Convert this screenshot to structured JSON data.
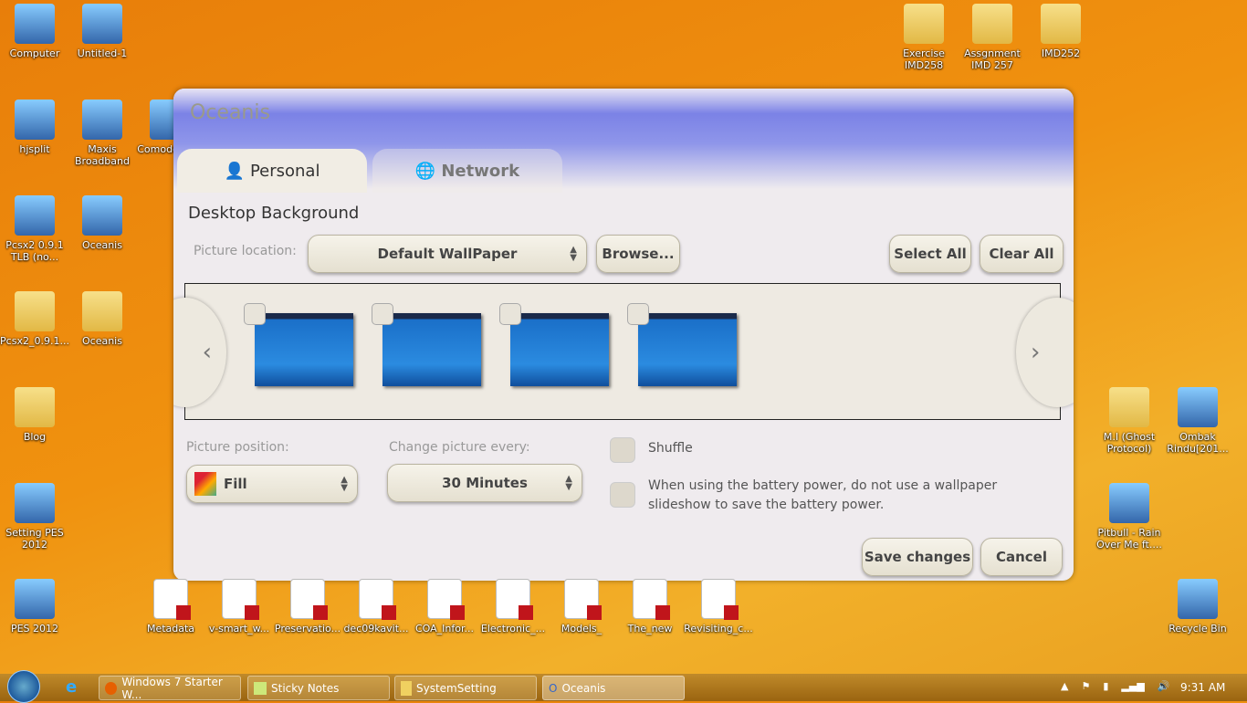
{
  "desktop": {
    "left_icons": [
      "Computer",
      "Untitled-1",
      "hjsplit",
      "Maxis Broadband",
      "Comodo Dr...",
      "Pcsx2 0.9.1 TLB (no...",
      "Oceanis",
      "Pcsx2_0.9.1...",
      "Oceanis",
      "Blog",
      "Setting PES 2012",
      "PES 2012"
    ],
    "top_right_icons": [
      "Exercise IMD258",
      "Assgnment IMD 257",
      "IMD252"
    ],
    "right_icons": [
      "M.I (Ghost Protocol)",
      "Ombak Rindu[201...",
      "Pitbull - Rain Over Me ft....",
      "Recycle Bin"
    ],
    "pdf_icons": [
      "Metadata",
      "v-smart_w...",
      "Preservatio...",
      "dec09kavit...",
      "COA_Infor...",
      "Electronic_...",
      "Models_",
      "The_new",
      "Revisiting_c..."
    ]
  },
  "dialog": {
    "title": "Oceanis",
    "tabs": [
      {
        "label": "Personal",
        "icon": "person-icon"
      },
      {
        "label": "Network",
        "icon": "globe-icon"
      }
    ],
    "section_title": "Desktop Background",
    "picture_location_label": "Picture location:",
    "picture_location_value": "Default WallPaper",
    "browse": "Browse...",
    "select_all": "Select All",
    "clear_all": "Clear All",
    "thumbnails": [
      {
        "checked": false
      },
      {
        "checked": false
      },
      {
        "checked": false
      },
      {
        "checked": false
      }
    ],
    "picture_position_label": "Picture position:",
    "picture_position_value": "Fill",
    "change_picture_label": "Change picture every:",
    "change_picture_value": "30 Minutes",
    "shuffle_label": "Shuffle",
    "battery_label": "When using the battery power, do not use a wallpaper slideshow to save the battery power.",
    "save": "Save changes",
    "cancel": "Cancel"
  },
  "taskbar": {
    "items": [
      "Windows 7 Starter W...",
      "Sticky Notes",
      "SystemSetting",
      "Oceanis"
    ],
    "clock": "9:31 AM"
  }
}
